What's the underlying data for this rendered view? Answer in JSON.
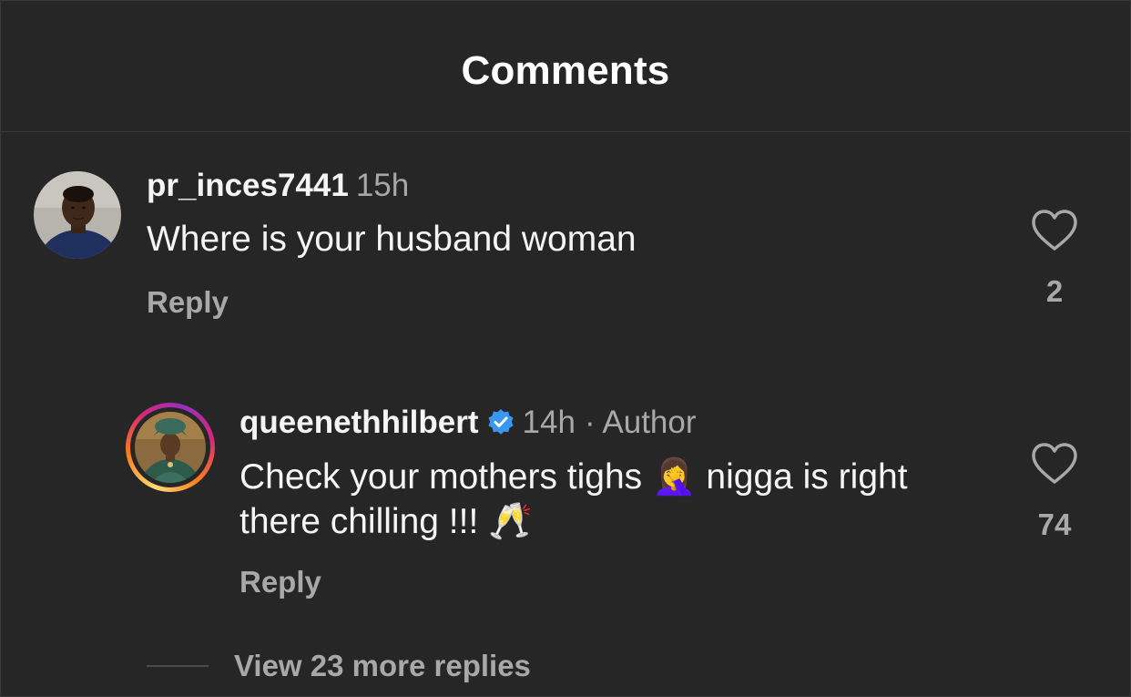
{
  "header": {
    "title": "Comments"
  },
  "comments": [
    {
      "username": "pr_inces7441",
      "time": "15h",
      "text": "Where is your husband woman",
      "reply_label": "Reply",
      "like_count": "2",
      "like_icon": "heart-outline-icon"
    },
    {
      "username": "queenethhilbert",
      "verified": true,
      "time": "14h",
      "author_label": "· Author",
      "text_part1": "Check your mothers tighs ",
      "emoji1": "🤦‍♀️",
      "text_part2": " nigga is right there chilling !!! ",
      "emoji2": "🥂",
      "reply_label": "Reply",
      "like_count": "74",
      "like_icon": "heart-outline-icon"
    }
  ],
  "view_more": {
    "label": "View 23 more replies"
  },
  "colors": {
    "background": "#262626",
    "primary_text": "#f5f5f5",
    "secondary_text": "#a8a8a8",
    "verified_blue": "#3897f0",
    "divider": "#3a3a3a"
  }
}
